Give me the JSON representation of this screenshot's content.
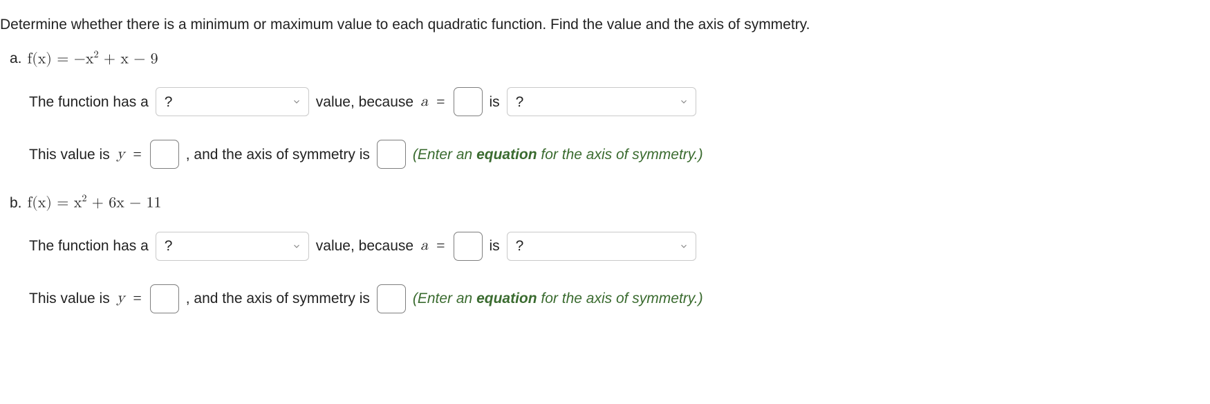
{
  "intro": "Determine whether there is a minimum or maximum value to each quadratic function. Find the value and the axis of symmetry.",
  "parts": {
    "a": {
      "letter": "a.",
      "equation_html": "f(x) = −x<sup>2</sup> + x − 9",
      "line1": {
        "t1": "The function has a",
        "select1": "?",
        "t2": "value, because",
        "avar": "a",
        "eq": "=",
        "t3": "is",
        "select2": "?"
      },
      "line2": {
        "t1": "This value is",
        "yvar": "y",
        "eq": "=",
        "t2": ", and the axis of symmetry is",
        "hint_pre": "(Enter an ",
        "hint_bold": "equation",
        "hint_post": " for the axis of symmetry.)"
      }
    },
    "b": {
      "letter": "b.",
      "equation_html": "f(x) = x<sup>2</sup> + 6x − 11",
      "line1": {
        "t1": "The function has a",
        "select1": "?",
        "t2": "value, because",
        "avar": "a",
        "eq": "=",
        "t3": "is",
        "select2": "?"
      },
      "line2": {
        "t1": "This value is",
        "yvar": "y",
        "eq": "=",
        "t2": ", and the axis of symmetry is",
        "hint_pre": "(Enter an ",
        "hint_bold": "equation",
        "hint_post": " for the axis of symmetry.)"
      }
    }
  }
}
